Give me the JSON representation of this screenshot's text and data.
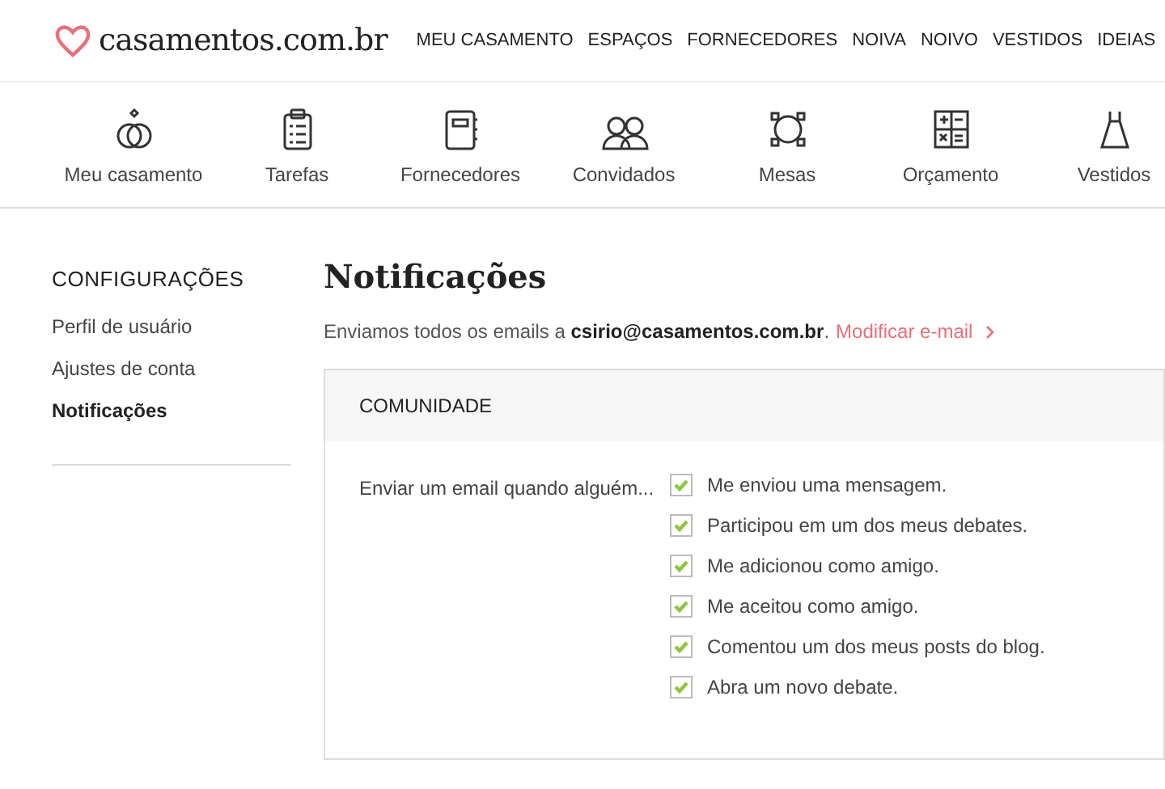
{
  "header": {
    "logo": "casamentos.com.br",
    "nav": [
      "MEU CASAMENTO",
      "ESPAÇOS",
      "FORNECEDORES",
      "NOIVA",
      "NOIVO",
      "VESTIDOS",
      "IDEIAS"
    ]
  },
  "tools": [
    {
      "kind": "rings",
      "label": "Meu casamento"
    },
    {
      "kind": "clipboard",
      "label": "Tarefas"
    },
    {
      "kind": "notebook",
      "label": "Fornecedores"
    },
    {
      "kind": "guests",
      "label": "Convidados"
    },
    {
      "kind": "table",
      "label": "Mesas"
    },
    {
      "kind": "calculator",
      "label": "Orçamento"
    },
    {
      "kind": "dress",
      "label": "Vestidos"
    }
  ],
  "sidebar": {
    "title": "CONFIGURAÇÕES",
    "items": [
      {
        "label": "Perfil de usuário",
        "selected": false
      },
      {
        "label": "Ajustes de conta",
        "selected": false
      },
      {
        "label": "Notificações",
        "selected": true
      }
    ]
  },
  "main": {
    "title": "Notificações",
    "email_note": "Enviamos todos os emails a **csirio@casamentos.com.br**.",
    "email_link": "Modificar e-mail",
    "section": {
      "title": "COMUNIDADE",
      "prompt": "Enviar um email quando alguém...",
      "options": [
        {
          "label": "Me enviou uma mensagem.",
          "checked": true
        },
        {
          "label": "Participou em um dos meus debates.",
          "checked": true
        },
        {
          "label": "Me adicionou como amigo.",
          "checked": true
        },
        {
          "label": "Me aceitou como amigo.",
          "checked": true
        },
        {
          "label": "Comentou um dos meus posts do blog.",
          "checked": true
        },
        {
          "label": "Abra um novo debate.",
          "checked": true
        }
      ]
    }
  }
}
